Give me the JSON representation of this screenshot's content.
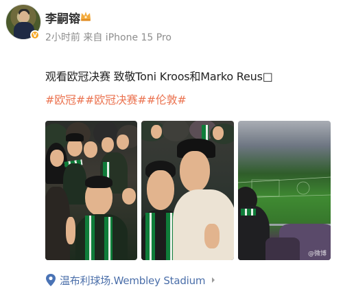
{
  "post": {
    "username": "李嗣镕",
    "meta": "2小时前  来自 iPhone 15 Pro",
    "content": "观看欧冠决赛 致敬Toni Kroos和Marko Reus□",
    "hashtags": "#欧冠##欧冠决赛##伦敦#",
    "watermark": "@微博",
    "location": "温布利球场.Wembley Stadium"
  },
  "icons": {
    "verified": "verified-badge-icon",
    "member": "crown-icon",
    "location": "location-pin-icon",
    "chevron": "chevron-right-icon"
  },
  "colors": {
    "hashtag": "#eb7350",
    "location": "#4a6ea9",
    "meta": "#8d8d8d",
    "verified": "#f5a623"
  }
}
